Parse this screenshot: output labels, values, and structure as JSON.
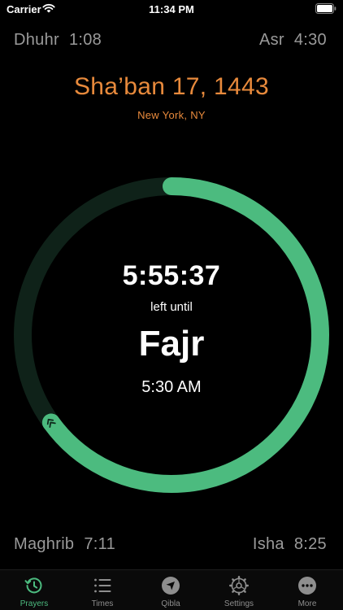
{
  "status_bar": {
    "carrier": "Carrier",
    "time": "11:34 PM"
  },
  "top_prayers": {
    "left": {
      "name": "Dhuhr",
      "time": "1:08"
    },
    "right": {
      "name": "Asr",
      "time": "4:30"
    }
  },
  "hijri_date": "Sha’ban 17, 1443",
  "location": "New York, NY",
  "countdown": {
    "remaining": "5:55:37",
    "caption": "left until",
    "prayer": "Fajr",
    "prayer_time": "5:30 AM",
    "elapsed_fraction": 0.35
  },
  "bottom_prayers": {
    "left": {
      "name": "Maghrib",
      "time": "7:11"
    },
    "right": {
      "name": "Isha",
      "time": "8:25"
    }
  },
  "tabs": [
    {
      "label": "Prayers",
      "icon": "clock-history-icon",
      "active": true
    },
    {
      "label": "Times",
      "icon": "list-icon",
      "active": false
    },
    {
      "label": "Qibla",
      "icon": "compass-arrow-icon",
      "active": false
    },
    {
      "label": "Settings",
      "icon": "gear-icon",
      "active": false
    },
    {
      "label": "More",
      "icon": "more-dots-icon",
      "active": false
    }
  ],
  "colors": {
    "accent": "#4cbb7f",
    "ring_track": "#0f2219",
    "date": "#e88a3c",
    "muted_text": "#9a9a9a"
  }
}
